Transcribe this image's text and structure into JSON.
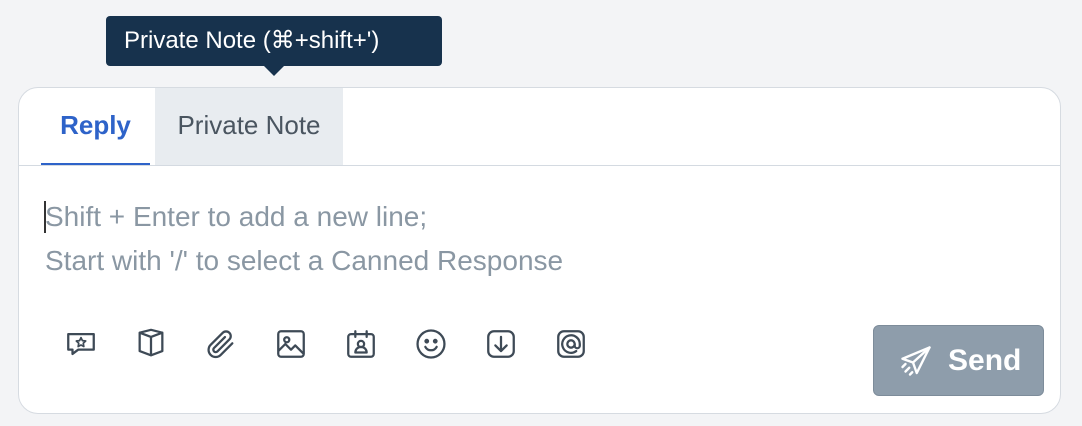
{
  "tooltip": {
    "text": "Private Note (⌘+shift+')"
  },
  "tabs": [
    {
      "label": "Reply",
      "active": true
    },
    {
      "label": "Private Note",
      "active": false
    }
  ],
  "editor": {
    "placeholder_line1": "Shift + Enter to add a new line;",
    "placeholder_line2": "Start with '/' to select a Canned Response"
  },
  "toolbar": {
    "icons": [
      "star-message-icon",
      "book-icon",
      "paperclip-icon",
      "image-icon",
      "calendar-user-icon",
      "emoji-icon",
      "download-icon",
      "at-mention-icon"
    ]
  },
  "send_button": {
    "label": "Send",
    "icon": "paper-plane-icon",
    "disabled": true
  },
  "colors": {
    "accent": "#2e63c9",
    "tooltip_bg": "#17324d",
    "send_disabled": "#8e9dab",
    "placeholder": "#8a97a3",
    "icon": "#3e4a56"
  }
}
